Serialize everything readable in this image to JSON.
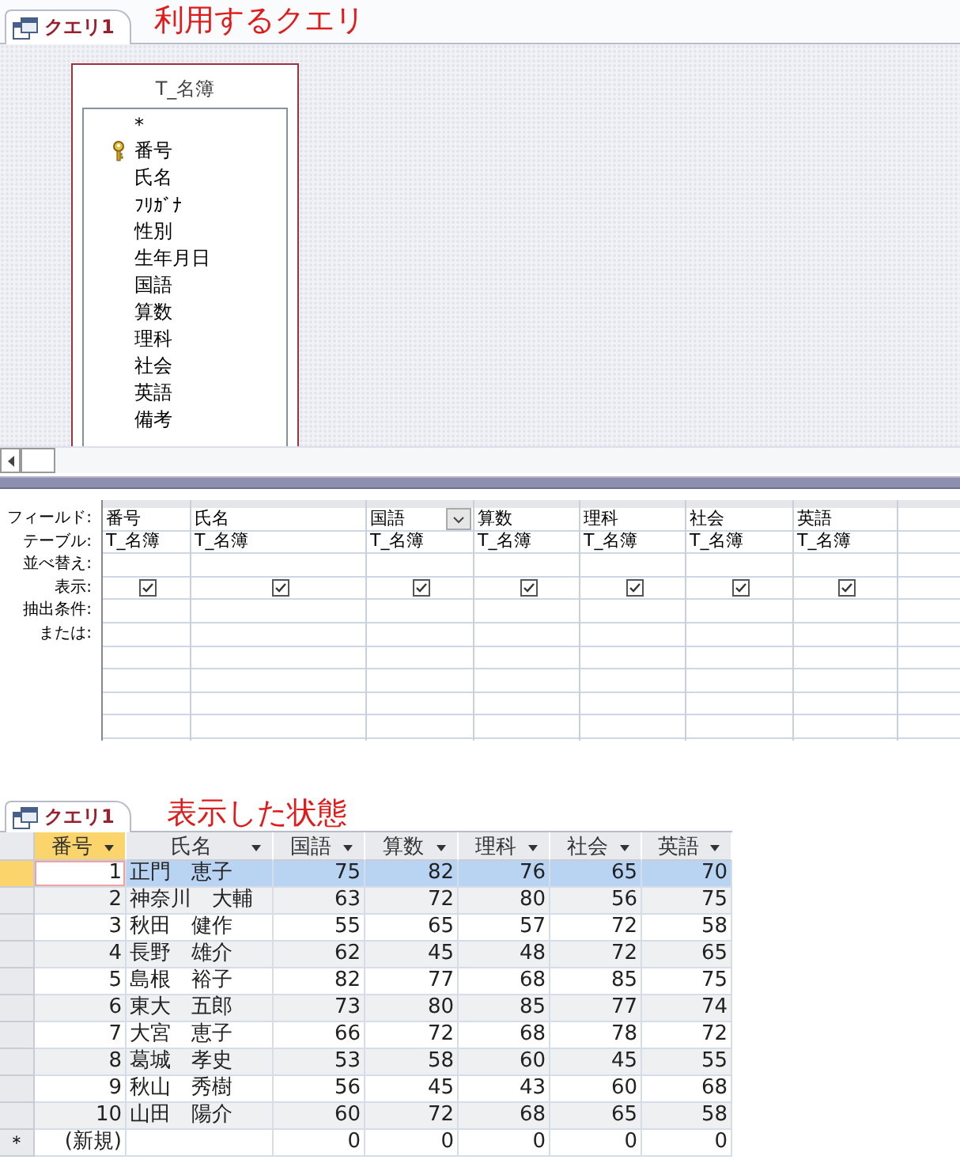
{
  "design_view": {
    "tab": {
      "label": "クエリ1",
      "selected": true
    },
    "annotation": "利用するクエリ",
    "field_list": {
      "title": "T_名簿",
      "fields": [
        {
          "name": "*",
          "primary_key": false
        },
        {
          "name": "番号",
          "primary_key": true
        },
        {
          "name": "氏名",
          "primary_key": false
        },
        {
          "name": "ﾌﾘｶﾞﾅ",
          "primary_key": false
        },
        {
          "name": "性別",
          "primary_key": false
        },
        {
          "name": "生年月日",
          "primary_key": false
        },
        {
          "name": "国語",
          "primary_key": false
        },
        {
          "name": "算数",
          "primary_key": false
        },
        {
          "name": "理科",
          "primary_key": false
        },
        {
          "name": "社会",
          "primary_key": false
        },
        {
          "name": "英語",
          "primary_key": false
        },
        {
          "name": "備考",
          "primary_key": false
        }
      ]
    },
    "design_grid": {
      "row_labels": [
        "フィールド:",
        "テーブル:",
        "並べ替え:",
        "表示:",
        "抽出条件:",
        "または:"
      ],
      "columns": [
        {
          "field": "番号",
          "table": "T_名簿",
          "show": true,
          "dropdown": false
        },
        {
          "field": "氏名",
          "table": "T_名簿",
          "show": true,
          "dropdown": false
        },
        {
          "field": "国語",
          "table": "T_名簿",
          "show": true,
          "dropdown": true
        },
        {
          "field": "算数",
          "table": "T_名簿",
          "show": true,
          "dropdown": false
        },
        {
          "field": "理科",
          "table": "T_名簿",
          "show": true,
          "dropdown": false
        },
        {
          "field": "社会",
          "table": "T_名簿",
          "show": true,
          "dropdown": false
        },
        {
          "field": "英語",
          "table": "T_名簿",
          "show": true,
          "dropdown": false
        }
      ]
    }
  },
  "datasheet_view": {
    "tab": {
      "label": "クエリ1",
      "selected": true
    },
    "annotation": "表示した状態",
    "columns": [
      {
        "label": "番号",
        "selected": true
      },
      {
        "label": "氏名",
        "selected": false
      },
      {
        "label": "国語",
        "selected": false
      },
      {
        "label": "算数",
        "selected": false
      },
      {
        "label": "理科",
        "selected": false
      },
      {
        "label": "社会",
        "selected": false
      },
      {
        "label": "英語",
        "selected": false
      }
    ],
    "rows": [
      {
        "selected": true,
        "cells": [
          "1",
          "正門　恵子",
          "75",
          "82",
          "76",
          "65",
          "70"
        ]
      },
      {
        "selected": false,
        "cells": [
          "2",
          "神奈川　大輔",
          "63",
          "72",
          "80",
          "56",
          "75"
        ]
      },
      {
        "selected": false,
        "cells": [
          "3",
          "秋田　健作",
          "55",
          "65",
          "57",
          "72",
          "58"
        ]
      },
      {
        "selected": false,
        "cells": [
          "4",
          "長野　雄介",
          "62",
          "45",
          "48",
          "72",
          "65"
        ]
      },
      {
        "selected": false,
        "cells": [
          "5",
          "島根　裕子",
          "82",
          "77",
          "68",
          "85",
          "75"
        ]
      },
      {
        "selected": false,
        "cells": [
          "6",
          "東大　五郎",
          "73",
          "80",
          "85",
          "77",
          "74"
        ]
      },
      {
        "selected": false,
        "cells": [
          "7",
          "大宮　恵子",
          "66",
          "72",
          "68",
          "78",
          "72"
        ]
      },
      {
        "selected": false,
        "cells": [
          "8",
          "葛城　孝史",
          "53",
          "58",
          "60",
          "45",
          "55"
        ]
      },
      {
        "selected": false,
        "cells": [
          "9",
          "秋山　秀樹",
          "56",
          "45",
          "43",
          "60",
          "68"
        ]
      },
      {
        "selected": false,
        "cells": [
          "10",
          "山田　陽介",
          "60",
          "72",
          "68",
          "65",
          "58"
        ]
      }
    ],
    "new_row": {
      "marker": "＊",
      "cells": [
        "(新規)",
        "",
        "0",
        "0",
        "0",
        "0",
        "0"
      ]
    }
  }
}
